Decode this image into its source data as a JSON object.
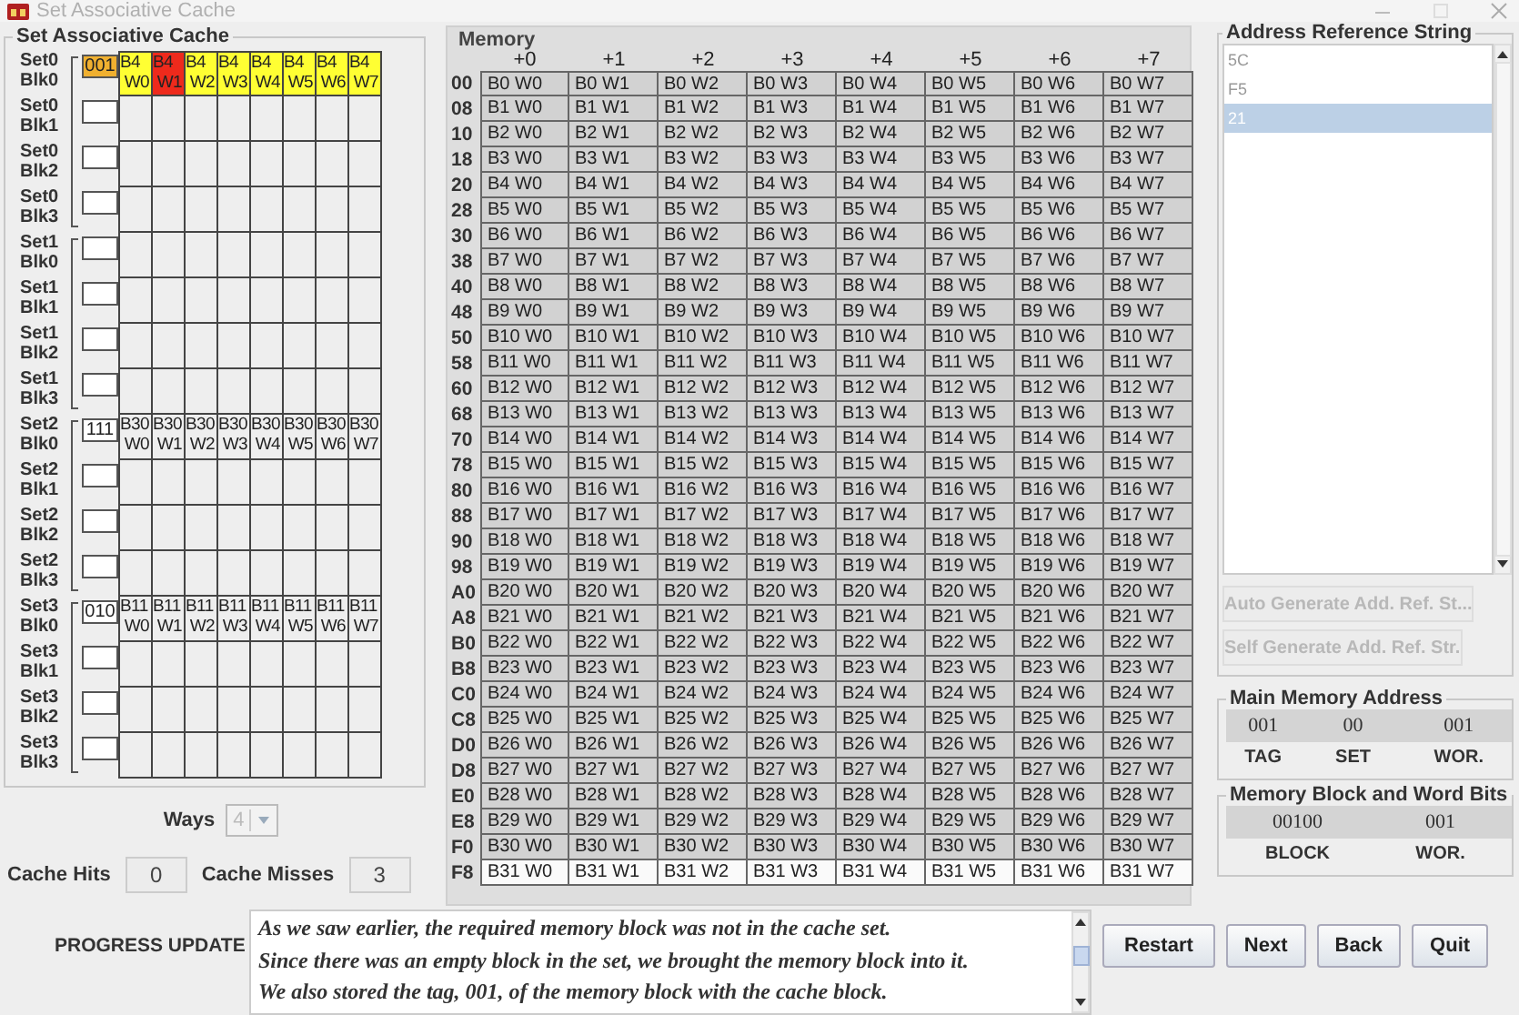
{
  "window": {
    "title": "Set Associative Cache"
  },
  "cache": {
    "title": "Set Associative Cache",
    "sets": [
      {
        "blocks": [
          {
            "label": "Set0 Blk0",
            "tag": {
              "text": "001",
              "color": "#f0b030"
            },
            "words": [
              {
                "block": "B4",
                "word": "W0",
                "color": "#ffff33"
              },
              {
                "block": "B4",
                "word": "W1",
                "color": "#ee2a1c"
              },
              {
                "block": "B4",
                "word": "W2",
                "color": "#ffff33"
              },
              {
                "block": "B4",
                "word": "W3",
                "color": "#ffff33"
              },
              {
                "block": "B4",
                "word": "W4",
                "color": "#ffff33"
              },
              {
                "block": "B4",
                "word": "W5",
                "color": "#ffff33"
              },
              {
                "block": "B4",
                "word": "W6",
                "color": "#ffff33"
              },
              {
                "block": "B4",
                "word": "W7",
                "color": "#ffff33"
              }
            ]
          },
          {
            "label": "Set0 Blk1"
          },
          {
            "label": "Set0 Blk2"
          },
          {
            "label": "Set0 Blk3"
          }
        ]
      },
      {
        "blocks": [
          {
            "label": "Set1 Blk0"
          },
          {
            "label": "Set1 Blk1"
          },
          {
            "label": "Set1 Blk2"
          },
          {
            "label": "Set1 Blk3"
          }
        ]
      },
      {
        "blocks": [
          {
            "label": "Set2 Blk0",
            "tag": {
              "text": "111"
            },
            "words": [
              {
                "block": "B30",
                "word": "W0"
              },
              {
                "block": "B30",
                "word": "W1"
              },
              {
                "block": "B30",
                "word": "W2"
              },
              {
                "block": "B30",
                "word": "W3"
              },
              {
                "block": "B30",
                "word": "W4"
              },
              {
                "block": "B30",
                "word": "W5"
              },
              {
                "block": "B30",
                "word": "W6"
              },
              {
                "block": "B30",
                "word": "W7"
              }
            ]
          },
          {
            "label": "Set2 Blk1"
          },
          {
            "label": "Set2 Blk2"
          },
          {
            "label": "Set2 Blk3"
          }
        ]
      },
      {
        "blocks": [
          {
            "label": "Set3 Blk0",
            "tag": {
              "text": "010"
            },
            "words": [
              {
                "block": "B11",
                "word": "W0"
              },
              {
                "block": "B11",
                "word": "W1"
              },
              {
                "block": "B11",
                "word": "W2"
              },
              {
                "block": "B11",
                "word": "W3"
              },
              {
                "block": "B11",
                "word": "W4"
              },
              {
                "block": "B11",
                "word": "W5"
              },
              {
                "block": "B11",
                "word": "W6"
              },
              {
                "block": "B11",
                "word": "W7"
              }
            ]
          },
          {
            "label": "Set3 Blk1"
          },
          {
            "label": "Set3 Blk2"
          },
          {
            "label": "Set3 Blk3"
          }
        ]
      }
    ]
  },
  "ways": {
    "label": "Ways",
    "value": "4",
    "disabled": true
  },
  "stats": [
    {
      "label": "Cache Hits",
      "value": "0"
    },
    {
      "label": "Cache Misses",
      "value": "3"
    }
  ],
  "memory": {
    "title": "Memory",
    "columns": [
      "+0",
      "+1",
      "+2",
      "+3",
      "+4",
      "+5",
      "+6",
      "+7"
    ],
    "rows": [
      {
        "address": "00",
        "shaded": true,
        "cells": [
          "B0 W0",
          "B0 W1",
          "B0 W2",
          "B0 W3",
          "B0 W4",
          "B0 W5",
          "B0 W6",
          "B0 W7"
        ]
      },
      {
        "address": "08",
        "shaded": true,
        "cells": [
          "B1 W0",
          "B1 W1",
          "B1 W2",
          "B1 W3",
          "B1 W4",
          "B1 W5",
          "B1 W6",
          "B1 W7"
        ]
      },
      {
        "address": "10",
        "shaded": true,
        "cells": [
          "B2 W0",
          "B2 W1",
          "B2 W2",
          "B2 W3",
          "B2 W4",
          "B2 W5",
          "B2 W6",
          "B2 W7"
        ]
      },
      {
        "address": "18",
        "shaded": true,
        "cells": [
          "B3 W0",
          "B3 W1",
          "B3 W2",
          "B3 W3",
          "B3 W4",
          "B3 W5",
          "B3 W6",
          "B3 W7"
        ]
      },
      {
        "address": "20",
        "shaded": true,
        "cells": [
          "B4 W0",
          "B4 W1",
          "B4 W2",
          "B4 W3",
          "B4 W4",
          "B4 W5",
          "B4 W6",
          "B4 W7"
        ]
      },
      {
        "address": "28",
        "shaded": true,
        "cells": [
          "B5 W0",
          "B5 W1",
          "B5 W2",
          "B5 W3",
          "B5 W4",
          "B5 W5",
          "B5 W6",
          "B5 W7"
        ]
      },
      {
        "address": "30",
        "shaded": true,
        "cells": [
          "B6 W0",
          "B6 W1",
          "B6 W2",
          "B6 W3",
          "B6 W4",
          "B6 W5",
          "B6 W6",
          "B6 W7"
        ]
      },
      {
        "address": "38",
        "shaded": true,
        "cells": [
          "B7 W0",
          "B7 W1",
          "B7 W2",
          "B7 W3",
          "B7 W4",
          "B7 W5",
          "B7 W6",
          "B7 W7"
        ]
      },
      {
        "address": "40",
        "shaded": true,
        "cells": [
          "B8 W0",
          "B8 W1",
          "B8 W2",
          "B8 W3",
          "B8 W4",
          "B8 W5",
          "B8 W6",
          "B8 W7"
        ]
      },
      {
        "address": "48",
        "shaded": true,
        "cells": [
          "B9 W0",
          "B9 W1",
          "B9 W2",
          "B9 W3",
          "B9 W4",
          "B9 W5",
          "B9 W6",
          "B9 W7"
        ]
      },
      {
        "address": "50",
        "shaded": true,
        "cells": [
          "B10 W0",
          "B10 W1",
          "B10 W2",
          "B10 W3",
          "B10 W4",
          "B10 W5",
          "B10 W6",
          "B10 W7"
        ]
      },
      {
        "address": "58",
        "shaded": true,
        "cells": [
          "B11 W0",
          "B11 W1",
          "B11 W2",
          "B11 W3",
          "B11 W4",
          "B11 W5",
          "B11 W6",
          "B11 W7"
        ]
      },
      {
        "address": "60",
        "shaded": true,
        "cells": [
          "B12 W0",
          "B12 W1",
          "B12 W2",
          "B12 W3",
          "B12 W4",
          "B12 W5",
          "B12 W6",
          "B12 W7"
        ]
      },
      {
        "address": "68",
        "shaded": true,
        "cells": [
          "B13 W0",
          "B13 W1",
          "B13 W2",
          "B13 W3",
          "B13 W4",
          "B13 W5",
          "B13 W6",
          "B13 W7"
        ]
      },
      {
        "address": "70",
        "shaded": true,
        "cells": [
          "B14 W0",
          "B14 W1",
          "B14 W2",
          "B14 W3",
          "B14 W4",
          "B14 W5",
          "B14 W6",
          "B14 W7"
        ]
      },
      {
        "address": "78",
        "shaded": true,
        "cells": [
          "B15 W0",
          "B15 W1",
          "B15 W2",
          "B15 W3",
          "B15 W4",
          "B15 W5",
          "B15 W6",
          "B15 W7"
        ]
      },
      {
        "address": "80",
        "shaded": true,
        "cells": [
          "B16 W0",
          "B16 W1",
          "B16 W2",
          "B16 W3",
          "B16 W4",
          "B16 W5",
          "B16 W6",
          "B16 W7"
        ]
      },
      {
        "address": "88",
        "shaded": true,
        "cells": [
          "B17 W0",
          "B17 W1",
          "B17 W2",
          "B17 W3",
          "B17 W4",
          "B17 W5",
          "B17 W6",
          "B17 W7"
        ]
      },
      {
        "address": "90",
        "shaded": true,
        "cells": [
          "B18 W0",
          "B18 W1",
          "B18 W2",
          "B18 W3",
          "B18 W4",
          "B18 W5",
          "B18 W6",
          "B18 W7"
        ]
      },
      {
        "address": "98",
        "shaded": true,
        "cells": [
          "B19 W0",
          "B19 W1",
          "B19 W2",
          "B19 W3",
          "B19 W4",
          "B19 W5",
          "B19 W6",
          "B19 W7"
        ]
      },
      {
        "address": "A0",
        "shaded": true,
        "cells": [
          "B20 W0",
          "B20 W1",
          "B20 W2",
          "B20 W3",
          "B20 W4",
          "B20 W5",
          "B20 W6",
          "B20 W7"
        ]
      },
      {
        "address": "A8",
        "shaded": true,
        "cells": [
          "B21 W0",
          "B21 W1",
          "B21 W2",
          "B21 W3",
          "B21 W4",
          "B21 W5",
          "B21 W6",
          "B21 W7"
        ]
      },
      {
        "address": "B0",
        "shaded": true,
        "cells": [
          "B22 W0",
          "B22 W1",
          "B22 W2",
          "B22 W3",
          "B22 W4",
          "B22 W5",
          "B22 W6",
          "B22 W7"
        ]
      },
      {
        "address": "B8",
        "shaded": true,
        "cells": [
          "B23 W0",
          "B23 W1",
          "B23 W2",
          "B23 W3",
          "B23 W4",
          "B23 W5",
          "B23 W6",
          "B23 W7"
        ]
      },
      {
        "address": "C0",
        "shaded": true,
        "cells": [
          "B24 W0",
          "B24 W1",
          "B24 W2",
          "B24 W3",
          "B24 W4",
          "B24 W5",
          "B24 W6",
          "B24 W7"
        ]
      },
      {
        "address": "C8",
        "shaded": true,
        "cells": [
          "B25 W0",
          "B25 W1",
          "B25 W2",
          "B25 W3",
          "B25 W4",
          "B25 W5",
          "B25 W6",
          "B25 W7"
        ]
      },
      {
        "address": "D0",
        "shaded": true,
        "cells": [
          "B26 W0",
          "B26 W1",
          "B26 W2",
          "B26 W3",
          "B26 W4",
          "B26 W5",
          "B26 W6",
          "B26 W7"
        ]
      },
      {
        "address": "D8",
        "shaded": true,
        "cells": [
          "B27 W0",
          "B27 W1",
          "B27 W2",
          "B27 W3",
          "B27 W4",
          "B27 W5",
          "B27 W6",
          "B27 W7"
        ]
      },
      {
        "address": "E0",
        "shaded": true,
        "cells": [
          "B28 W0",
          "B28 W1",
          "B28 W2",
          "B28 W3",
          "B28 W4",
          "B28 W5",
          "B28 W6",
          "B28 W7"
        ]
      },
      {
        "address": "E8",
        "shaded": true,
        "cells": [
          "B29 W0",
          "B29 W1",
          "B29 W2",
          "B29 W3",
          "B29 W4",
          "B29 W5",
          "B29 W6",
          "B29 W7"
        ]
      },
      {
        "address": "F0",
        "shaded": true,
        "cells": [
          "B30 W0",
          "B30 W1",
          "B30 W2",
          "B30 W3",
          "B30 W4",
          "B30 W5",
          "B30 W6",
          "B30 W7"
        ]
      },
      {
        "address": "F8",
        "shaded": false,
        "cells": [
          "B31 W0",
          "B31 W1",
          "B31 W2",
          "B31 W3",
          "B31 W4",
          "B31 W5",
          "B31 W6",
          "B31 W7"
        ]
      }
    ]
  },
  "address_reference": {
    "title": "Address Reference String",
    "items": [
      {
        "text": "5C",
        "selected": false
      },
      {
        "text": "F5",
        "selected": false
      },
      {
        "text": "21",
        "selected": true
      }
    ],
    "buttons": [
      {
        "label": "Auto Generate Add. Ref. St...",
        "disabled": true
      },
      {
        "label": "Self Generate Add. Ref. Str.",
        "disabled": true
      }
    ]
  },
  "main_memory_address": {
    "title": "Main Memory Address",
    "fields": [
      {
        "value": "001",
        "label": "TAG"
      },
      {
        "value": "00",
        "label": "SET"
      },
      {
        "value": "001",
        "label": "WOR."
      }
    ]
  },
  "block_word_bits": {
    "title": "Memory Block and Word Bits",
    "fields": [
      {
        "value": "00100",
        "label": "BLOCK"
      },
      {
        "value": "001",
        "label": "WOR."
      }
    ]
  },
  "progress": {
    "label": "PROGRESS UPDATE",
    "lines": [
      "As we saw earlier, the required memory block was not in the cache set.",
      "Since there was an empty block in the set, we brought the memory block into it.",
      "We also stored the tag, 001, of the memory block with the cache block."
    ]
  },
  "buttons": [
    {
      "label": "Restart"
    },
    {
      "label": "Next"
    },
    {
      "label": "Back"
    },
    {
      "label": "Quit"
    }
  ]
}
